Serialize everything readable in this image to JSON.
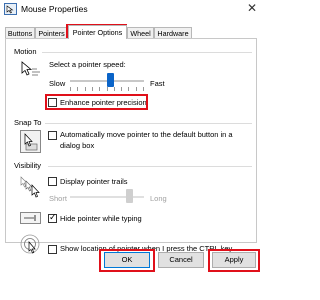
{
  "window": {
    "title": "Mouse Properties",
    "close_glyph": "✕"
  },
  "tabs": [
    {
      "label": "Buttons"
    },
    {
      "label": "Pointers"
    },
    {
      "label": "Pointer Options",
      "active": true
    },
    {
      "label": "Wheel"
    },
    {
      "label": "Hardware"
    }
  ],
  "motion": {
    "section": "Motion",
    "speed_label": "Select a pointer speed:",
    "slow": "Slow",
    "fast": "Fast",
    "speed_fraction": 0.55,
    "enhance_label": "Enhance pointer precision",
    "enhance_checked": false
  },
  "snap_to": {
    "section": "Snap To",
    "label_line1": "Automatically move pointer to the default button in a",
    "label_line2": "dialog box",
    "checked": false
  },
  "visibility": {
    "section": "Visibility",
    "trails_label": "Display pointer trails",
    "trails_checked": false,
    "short": "Short",
    "long": "Long",
    "trails_fraction": 0.8,
    "hide_label": "Hide pointer while typing",
    "hide_checked": true,
    "ctrl_label": "Show location of pointer when I press the CTRL key",
    "ctrl_checked": false
  },
  "buttons": {
    "ok": "OK",
    "cancel": "Cancel",
    "apply": "Apply"
  },
  "colors": {
    "accent": "#0078d7",
    "highlight": "#e0101a",
    "slider": "#0a64c8"
  },
  "icons": [
    "mouse-properties-icon",
    "pointer-speed-icon",
    "snap-to-icon",
    "pointer-trails-icon",
    "hide-pointer-icon",
    "ctrl-location-icon"
  ]
}
